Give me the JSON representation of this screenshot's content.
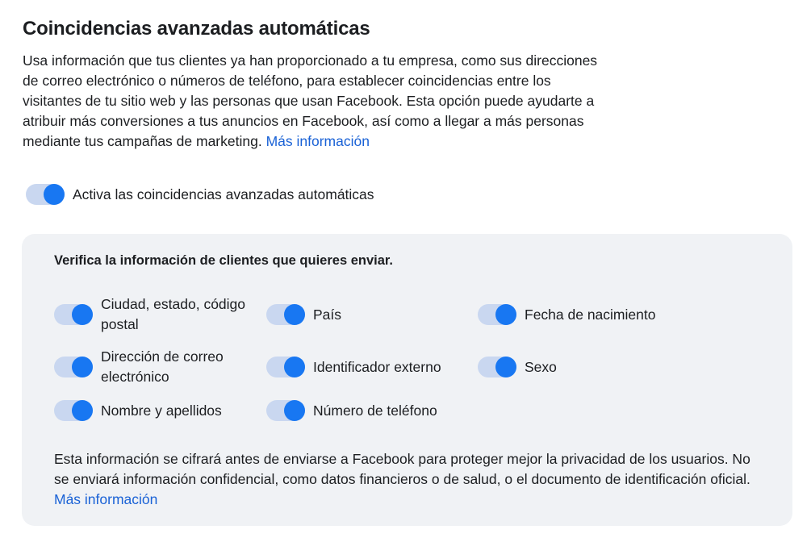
{
  "header": {
    "title": "Coincidencias avanzadas automáticas",
    "description": "Usa información que tus clientes ya han proporcionado a tu empresa, como sus direcciones de correo electrónico o números de teléfono, para establecer coincidencias entre los visitantes de tu sitio web y las personas que usan Facebook. Esta opción puede ayudarte a atribuir más conversiones a tus anuncios en Facebook, así como a llegar a más personas mediante tus campañas de marketing.",
    "learn_more": "Más información"
  },
  "main_toggle": {
    "label": "Activa las coincidencias avanzadas automáticas",
    "enabled": true
  },
  "panel": {
    "title": "Verifica la información de clientes que quieres enviar.",
    "options": [
      {
        "label": "Ciudad, estado, código postal",
        "enabled": true
      },
      {
        "label": "País",
        "enabled": true
      },
      {
        "label": "Fecha de nacimiento",
        "enabled": true
      },
      {
        "label": "Dirección de correo electrónico",
        "enabled": true
      },
      {
        "label": "Identificador externo",
        "enabled": true
      },
      {
        "label": "Sexo",
        "enabled": true
      },
      {
        "label": "Nombre y apellidos",
        "enabled": true
      },
      {
        "label": "Número de teléfono",
        "enabled": true
      }
    ],
    "footnote": "Esta información se cifrará antes de enviarse a Facebook para proteger mejor la privacidad de los usuarios. No se enviará información confidencial, como datos financieros o de salud, o el documento de identificación oficial.",
    "learn_more": "Más información"
  },
  "colors": {
    "accent": "#1877f2",
    "track": "#c9d7f0",
    "link": "#1a62d6",
    "panel_bg": "#f0f2f5",
    "text": "#1c1e21"
  }
}
